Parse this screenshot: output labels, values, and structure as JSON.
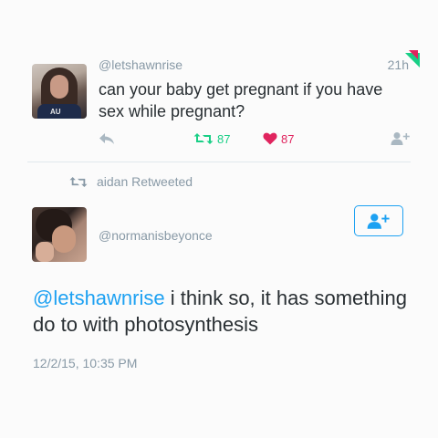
{
  "tweet1": {
    "handle": "@letshawnrise",
    "time": "21h",
    "text": "can your baby get pregnant if you have sex while pregnant?",
    "avatar_text": "AU",
    "retweets": "87",
    "likes": "87"
  },
  "retweet_context": {
    "text": "aidan Retweeted"
  },
  "tweet2": {
    "handle": "@normanisbeyonce",
    "mention": "@letshawnrise",
    "text": " i think so, it has something do to with photosynthesis",
    "date": "12/2/15, 10:35 PM"
  },
  "icons": {
    "reply": "reply-icon",
    "retweet": "retweet-icon",
    "like": "heart-icon",
    "follow": "add-user-icon"
  },
  "colors": {
    "retweet": "#19cf86",
    "like": "#e0245e",
    "link": "#1da1f2",
    "muted": "#8899a6"
  }
}
